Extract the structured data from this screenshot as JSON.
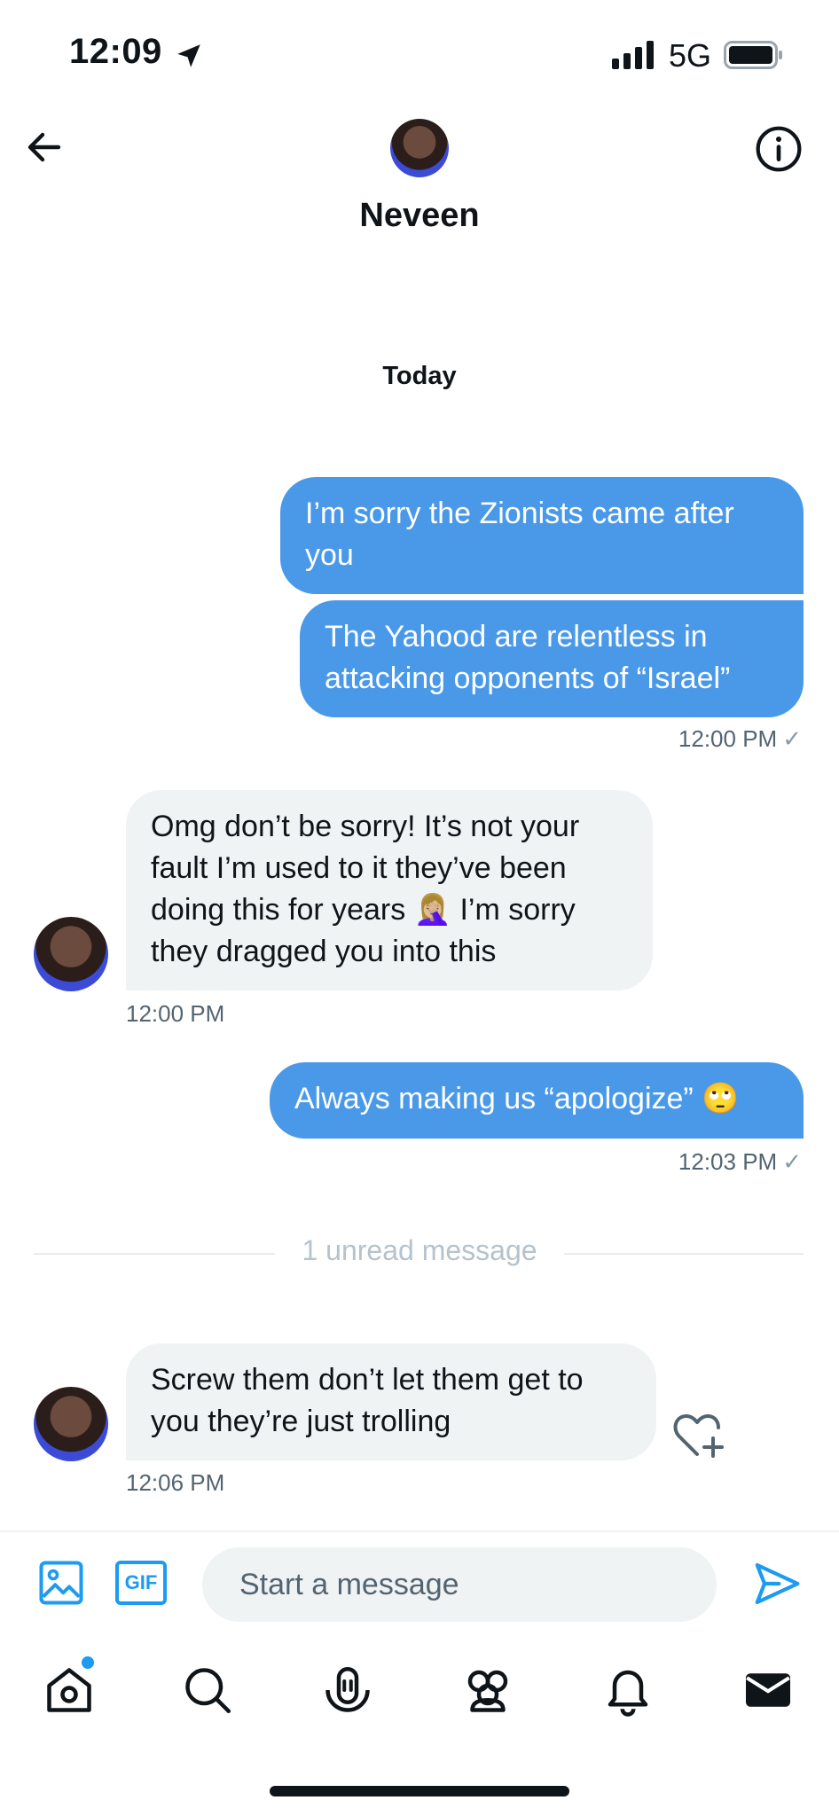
{
  "status_bar": {
    "time": "12:09",
    "network": "5G"
  },
  "header": {
    "name": "Neveen"
  },
  "conversation": {
    "day_label": "Today",
    "messages": [
      {
        "text": "I’m sorry the Zionists came after you"
      },
      {
        "text": "The Yahood are relentless in attacking opponents of “Israel”"
      },
      {
        "time": "12:00 PM"
      },
      {
        "text": "Omg don’t be sorry! It’s not your fault I’m used to it they’ve been doing this for years 🤦🏼‍♀️ I’m sorry they dragged you into this",
        "time": "12:00 PM"
      },
      {
        "text": "Always making us “apologize” 🙄",
        "time": "12:03 PM"
      },
      {
        "text": "Screw them don’t let them get to you they’re just trolling",
        "time": "12:06 PM"
      }
    ],
    "unread_divider": "1 unread message",
    "read_check": "✓"
  },
  "composer": {
    "gif_label": "GIF",
    "placeholder": "Start a message"
  },
  "colors": {
    "accent": "#1d9bf0",
    "outgoing_bubble": "#4a99e9",
    "incoming_bubble": "#eff3f4"
  }
}
